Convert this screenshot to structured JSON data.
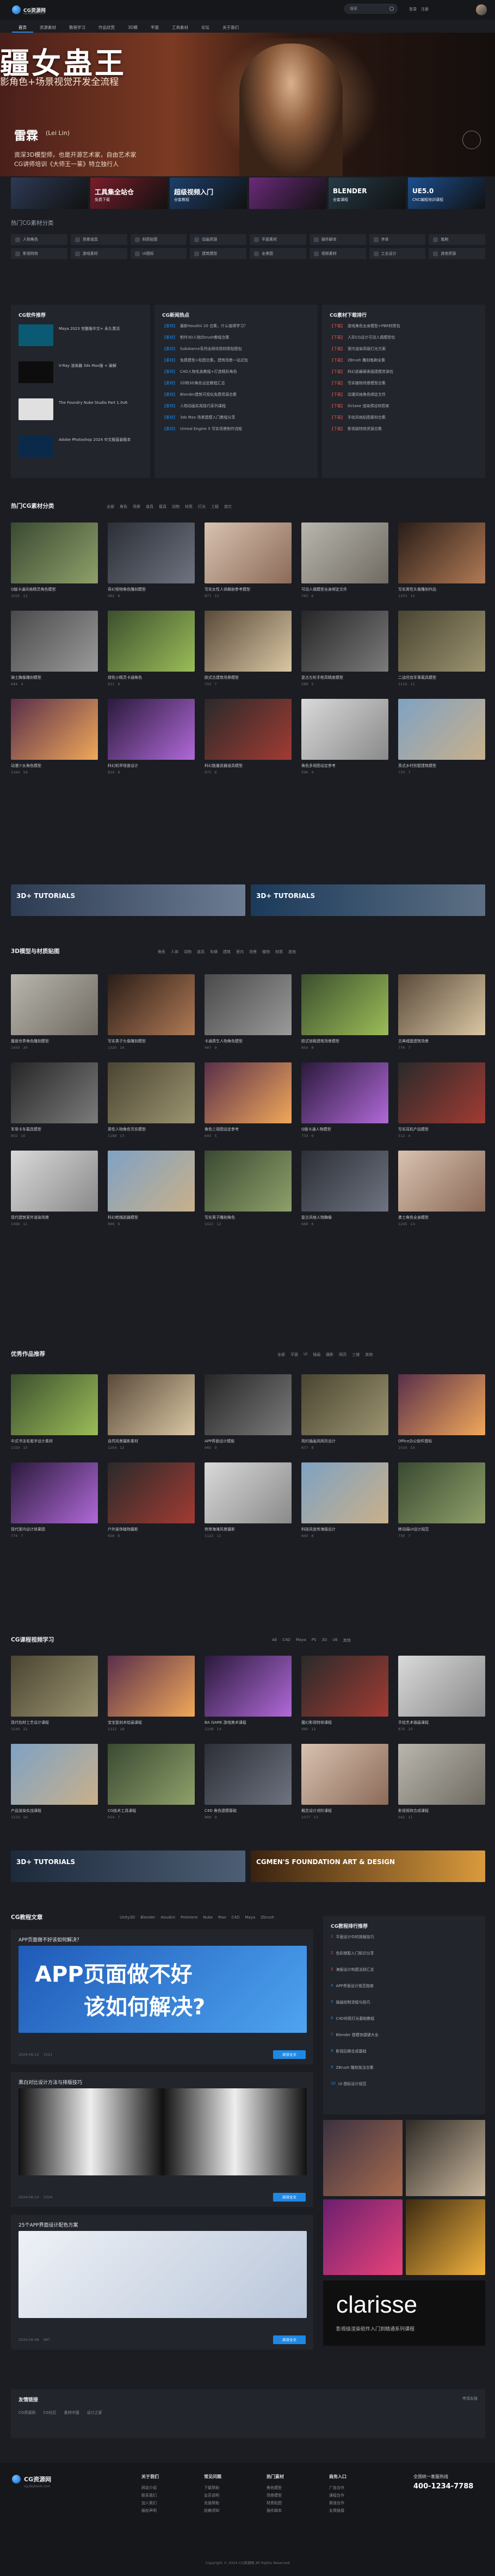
{
  "header": {
    "logo_text": "CG资源网",
    "logo_sub": "cg.skybook.com",
    "search_placeholder": "搜索",
    "links": [
      "登录",
      "注册"
    ],
    "nav": [
      "首页",
      "资源素材",
      "教程学习",
      "作品欣赏",
      "3D模",
      "平面",
      "工具素材",
      "论坛",
      "关于我们"
    ]
  },
  "hero": {
    "title": "疆女蛊王",
    "subtitle": "影角色+场景视觉开发全流程",
    "artist": "雷霖",
    "artist_en": "(Lei Lin)",
    "desc_1": "资深3D模型师，也是开源艺术家，自由艺术家",
    "desc_2": "CG讲师培训《大师王一篆》特立独行人",
    "slides": 6,
    "active_slide": 0
  },
  "promos": [
    {
      "title": "",
      "sub": ""
    },
    {
      "title": "工具集全站仓",
      "sub": "免费下载"
    },
    {
      "title": "超级视频入门",
      "sub": "全套教程"
    },
    {
      "title": "",
      "sub": ""
    },
    {
      "title": "BLENDER",
      "sub": "全套课程"
    },
    {
      "title": "UE5.0",
      "sub": "CNC编程培训课程"
    }
  ],
  "quick": {
    "title": "热门CG素材分类",
    "items": [
      "人物角色",
      "场景道具",
      "材质贴图",
      "动画资源",
      "平面素材",
      "插件脚本",
      "字体",
      "笔刷",
      "影视特效",
      "游戏素材",
      "UI图标",
      "建筑模型",
      "全景图",
      "视频素材",
      "工业设计",
      "其他资源"
    ]
  },
  "software_panel": {
    "title": "CG软件推荐",
    "items": [
      "Maya 2023 完整版中文+ 永久激活",
      "V-Ray 渲染器 3ds Max版 + 破解",
      "The Foundry Nuke Studio Part 1.0v6",
      "Adobe Photoshop 2024 中文版直装版本"
    ]
  },
  "news_panel": {
    "title": "CG新闻热点",
    "items": [
      {
        "tag": "【素材】",
        "text": "最新Houdini 20 合集，什么值得学习？"
      },
      {
        "tag": "【素材】",
        "text": "制作3D人物Zbrush教程合集"
      },
      {
        "tag": "【素材】",
        "text": "Substance系列全网优质材质贴图包"
      },
      {
        "tag": "【素材】",
        "text": "免费模型+贴图合集，建筑场景一站式包"
      },
      {
        "tag": "【素材】",
        "text": "C4D人物毛发教程+打造精彩角色"
      },
      {
        "tag": "【素材】",
        "text": "2D转3D角色设定教程汇总"
      },
      {
        "tag": "【素材】",
        "text": "Blender建筑可视化免费资源合集"
      },
      {
        "tag": "【素材】",
        "text": "人物动画实用技巧系列课程"
      },
      {
        "tag": "【素材】",
        "text": "3ds Max 场景建模入门教程分享"
      },
      {
        "tag": "【素材】",
        "text": "Unreal Engine 5 写实场景制作流程"
      }
    ]
  },
  "download_panel": {
    "title": "CG素材下载排行",
    "items": [
      {
        "tag": "【下载】",
        "text": "游戏角色全身模型+PBR材质包"
      },
      {
        "tag": "【下载】",
        "text": "人形CG设计可动人偶模型包"
      },
      {
        "tag": "【下载】",
        "text": "室内渲染高级灯光方案"
      },
      {
        "tag": "【下载】",
        "text": "ZBrush 雕刻笔刷全集"
      },
      {
        "tag": "【下载】",
        "text": "科幻武器硬表面建模资源包"
      },
      {
        "tag": "【下载】",
        "text": "写实植物场景模型合集"
      },
      {
        "tag": "【下载】",
        "text": "动漫风格角色绑定文件"
      },
      {
        "tag": "【下载】",
        "text": "Octane 渲染预设材质库"
      },
      {
        "tag": "【下载】",
        "text": "手绘风格贴图素材合集"
      },
      {
        "tag": "【下载】",
        "text": "影视级特效资源合集"
      }
    ]
  },
  "hot_section": {
    "title": "热门CG素材分类",
    "tabs": [
      "全部",
      "角色",
      "场景",
      "道具",
      "载具",
      "动物",
      "材质",
      "灯光",
      "工程",
      "其它"
    ],
    "cards": [
      {
        "title": "Q版卡通风格精灵角色模型",
        "views": "1025",
        "likes": "12"
      },
      {
        "title": "奇幻怪物角色雕刻模型",
        "views": "982",
        "likes": "8"
      },
      {
        "title": "写实女性人体解剖参考模型",
        "views": "877",
        "likes": "10"
      },
      {
        "title": "可动人偶模型全身绑定文件",
        "views": "765",
        "likes": "6"
      },
      {
        "title": "写实男性头像雕刻作品",
        "views": "1203",
        "likes": "15"
      },
      {
        "title": "骑士胸像雕刻模型",
        "views": "644",
        "likes": "4"
      },
      {
        "title": "绿色小精灵卡通角色",
        "views": "911",
        "likes": "9"
      },
      {
        "title": "欧式古建筑场景模型",
        "views": "702",
        "likes": "7"
      },
      {
        "title": "复古左轮手枪高精度模型",
        "views": "588",
        "likes": "5"
      },
      {
        "title": "二战坦克军事载具模型",
        "views": "1110",
        "likes": "11"
      },
      {
        "title": "动漫少女角色模型",
        "views": "1344",
        "likes": "18"
      },
      {
        "title": "科幻机甲怪兽设计",
        "views": "829",
        "likes": "8"
      },
      {
        "title": "科幻能量武器道具模型",
        "views": "675",
        "likes": "6"
      },
      {
        "title": "角色多视图设定参考",
        "views": "596",
        "likes": "4"
      },
      {
        "title": "英式乡村别墅建筑模型",
        "views": "733",
        "likes": "7"
      }
    ]
  },
  "banners_1": [
    {
      "title": "3D+ TUTORIALS"
    },
    {
      "title": "3D+ TUTORIALS"
    }
  ],
  "model_section": {
    "title": "3D模型与材质贴图",
    "tabs": [
      "角色",
      "人体",
      "动物",
      "道具",
      "车辆",
      "建筑",
      "室内",
      "场景",
      "植物",
      "材质",
      "其他"
    ],
    "cards": [
      {
        "title": "魔兽世界角色雕刻模型",
        "views": "1450",
        "likes": "20"
      },
      {
        "title": "写实男子头像雕刻模型",
        "views": "1320",
        "likes": "16"
      },
      {
        "title": "卡通男生人物角色模型",
        "views": "987",
        "likes": "9"
      },
      {
        "title": "欧式宫殿建筑场景模型",
        "views": "854",
        "likes": "8"
      },
      {
        "title": "古典城堡建筑场景",
        "views": "776",
        "likes": "7"
      },
      {
        "title": "军用卡车载具模型",
        "views": "902",
        "likes": "10"
      },
      {
        "title": "男性人物角色写实模型",
        "views": "1188",
        "likes": "13"
      },
      {
        "title": "角色三视图设定参考",
        "views": "645",
        "likes": "5"
      },
      {
        "title": "Q版卡通人物模型",
        "views": "733",
        "likes": "6"
      },
      {
        "title": "写实耳机产品模型",
        "views": "512",
        "likes": "4"
      },
      {
        "title": "现代建筑室外渲染场景",
        "views": "1066",
        "likes": "11"
      },
      {
        "title": "科幻枪械武器模型",
        "views": "899",
        "likes": "9"
      },
      {
        "title": "写实男子雕刻角色",
        "views": "1021",
        "likes": "12"
      },
      {
        "title": "复古风格人物胸像",
        "views": "688",
        "likes": "6"
      },
      {
        "title": "勇士角色全身模型",
        "views": "1245",
        "likes": "14"
      }
    ]
  },
  "works_section": {
    "title": "优秀作品推荐",
    "tabs": [
      "全部",
      "平面",
      "UI",
      "插画",
      "摄影",
      "网页",
      "三维",
      "其他"
    ],
    "cards": [
      {
        "title": "中式书法毛笔字设计素材",
        "views": "1320",
        "likes": "15"
      },
      {
        "title": "自然风景摄影素材",
        "views": "1204",
        "likes": "12"
      },
      {
        "title": "APP界面设计模板",
        "views": "965",
        "likes": "9"
      },
      {
        "title": "简约插画风网页设计",
        "views": "877",
        "likes": "8"
      },
      {
        "title": "Office办公软件图标",
        "views": "1010",
        "likes": "10"
      },
      {
        "title": "现代室内设计效果图",
        "views": "774",
        "likes": "7"
      },
      {
        "title": "户外装饰植物摄影",
        "views": "658",
        "likes": "6"
      },
      {
        "title": "热带海滩风景摄影",
        "views": "1122",
        "likes": "11"
      },
      {
        "title": "科技风宣传海报设计",
        "views": "840",
        "likes": "8"
      },
      {
        "title": "移动端UI设计规范",
        "views": "730",
        "likes": "7"
      }
    ]
  },
  "course_section": {
    "title": "CG课程视频学习",
    "tabs": [
      "AE",
      "C4D",
      "Maya",
      "PS",
      "3D",
      "UE",
      "其他"
    ],
    "cards": [
      {
        "title": "现代包材工艺设计课程",
        "views": "1540",
        "likes": "22"
      },
      {
        "title": "宝宝复刻术绘画课程",
        "views": "1312",
        "likes": "18"
      },
      {
        "title": "BA GAME 游戏美术课程",
        "views": "1108",
        "likes": "14"
      },
      {
        "title": "魔幻影视特效课程",
        "views": "980",
        "likes": "12"
      },
      {
        "title": "手绘艺术插画课程",
        "views": "876",
        "likes": "10"
      },
      {
        "title": "产品渲染实战课程",
        "views": "1233",
        "likes": "16"
      },
      {
        "title": "CG技术工具课程",
        "views": "654",
        "likes": "7"
      },
      {
        "title": "C4D 角色建模基础",
        "views": "888",
        "likes": "9"
      },
      {
        "title": "概念设计进阶课程",
        "views": "1077",
        "likes": "13"
      },
      {
        "title": "影视视效合成课程",
        "views": "942",
        "likes": "11"
      }
    ]
  },
  "banners_2": [
    {
      "title": "3D+ TUTORIALS"
    },
    {
      "title": "CGMEN'S FOUNDATION ART & DESIGN"
    }
  ],
  "articles_section": {
    "title": "CG教程文章",
    "tabs": [
      "Unity3D",
      "Blender",
      "Houdini",
      "Premiere",
      "Nuke",
      "Max",
      "C4D",
      "Maya",
      "Zbrush"
    ],
    "items": [
      {
        "title": "APP页面做不好该如何解决？",
        "headline": "APP页面做不好",
        "headline2": "该如何解决?",
        "date": "2024-06-12",
        "views": "1521",
        "button": "阅读全文"
      },
      {
        "title": "黑白对比设计方法与排版技巧",
        "headline": "",
        "headline2": "",
        "date": "2024-06-10",
        "views": "1024",
        "button": "阅读全文"
      },
      {
        "title": "25个APP界面设计配色方案",
        "headline": "",
        "headline2": "",
        "date": "2024-06-08",
        "views": "987",
        "button": "阅读全文"
      }
    ]
  },
  "side_list": {
    "title": "CG教程排行推荐",
    "items": [
      "平面设计中的排版技巧",
      "色彩搭配入门知识分享",
      "海报设计构图法则汇总",
      "APP界面设计规范指南",
      "插画绘制流程与技巧",
      "C4D材质灯光基础教程",
      "Blender 建模快捷键大全",
      "影视后期合成基础",
      "ZBrush 雕刻技法合集",
      "UI 图标设计规范"
    ]
  },
  "side_ad": {
    "title": "clarisse",
    "sub": "影视级渲染软件入门到精通系列课程"
  },
  "friends": {
    "title": "友情链接",
    "links": [
      "CG资源网",
      "CG社区",
      "素材中国",
      "设计之家"
    ],
    "apply": "申请友链"
  },
  "footer": {
    "logo_text": "CG资源网",
    "logo_sub": "cg.skybook.com",
    "cols": [
      {
        "title": "关于我们",
        "items": [
          "网站介绍",
          "联系我们",
          "加入我们",
          "版权声明"
        ]
      },
      {
        "title": "常见问题",
        "items": [
          "下载帮助",
          "会员说明",
          "充值帮助",
          "投稿须知"
        ]
      },
      {
        "title": "热门素材",
        "items": [
          "角色模型",
          "场景模型",
          "材质贴图",
          "插件脚本"
        ]
      },
      {
        "title": "商务入口",
        "items": [
          "广告合作",
          "课程合作",
          "渠道合作",
          "友情链接"
        ]
      }
    ],
    "hotline_title": "全国统一客服热线",
    "phone": "400-1234-7788",
    "copyright": "Copyright © 2024 CG资源网 All Rights Reserved"
  }
}
